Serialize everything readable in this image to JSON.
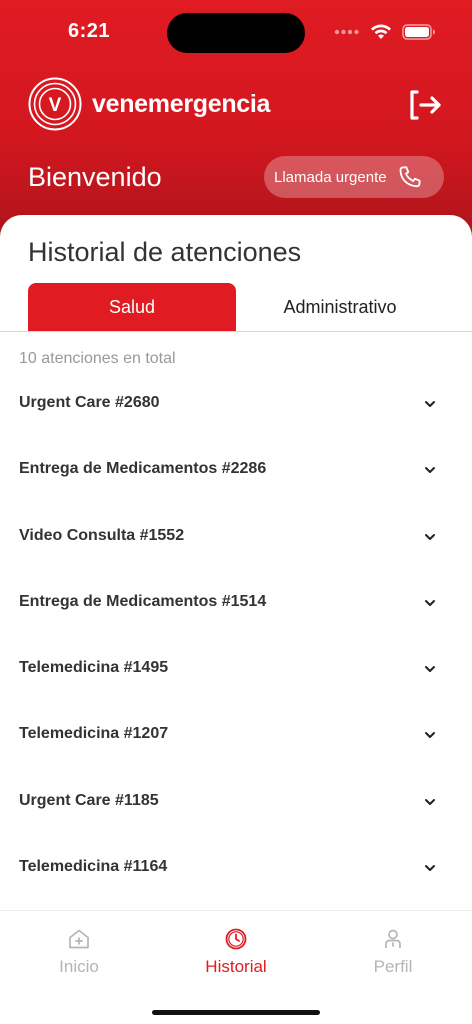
{
  "status_bar": {
    "time": "6:21"
  },
  "header": {
    "brand_name": "venemergencia",
    "logo_letter": "V",
    "welcome": "Bienvenido",
    "urgent_call_label": "Llamada urgente"
  },
  "history": {
    "title": "Historial de atenciones",
    "tabs": [
      {
        "label": "Salud",
        "active": true
      },
      {
        "label": "Administrativo",
        "active": false
      }
    ],
    "total_label": "10 atenciones en total",
    "items": [
      {
        "label": "Urgent Care #2680"
      },
      {
        "label": "Entrega de Medicamentos #2286"
      },
      {
        "label": "Video Consulta #1552"
      },
      {
        "label": "Entrega de Medicamentos #1514"
      },
      {
        "label": "Telemedicina #1495"
      },
      {
        "label": "Telemedicina #1207"
      },
      {
        "label": "Urgent Care #1185"
      },
      {
        "label": "Telemedicina #1164"
      }
    ]
  },
  "bottom_nav": [
    {
      "label": "Inicio",
      "icon": "home-icon",
      "active": false
    },
    {
      "label": "Historial",
      "icon": "clock-icon",
      "active": true
    },
    {
      "label": "Perfil",
      "icon": "user-icon",
      "active": false
    }
  ],
  "colors": {
    "brand_red": "#e01b22",
    "text_dark": "#333333",
    "muted": "#b5b5b5"
  }
}
